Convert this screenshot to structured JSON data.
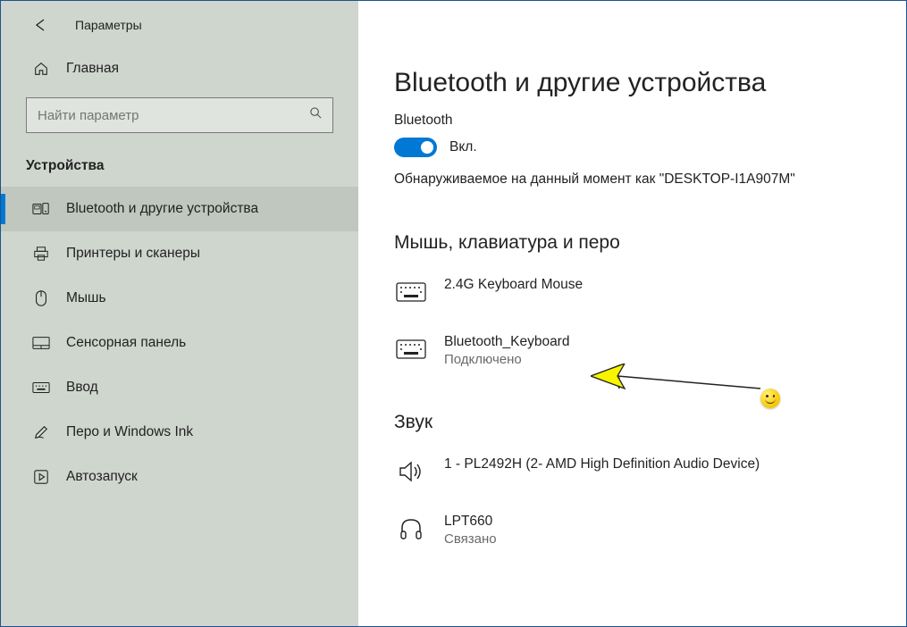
{
  "header": {
    "title": "Параметры"
  },
  "sidebar": {
    "home_label": "Главная",
    "search_placeholder": "Найти параметр",
    "section_label": "Устройства",
    "items": [
      {
        "label": "Bluetooth и другие устройства",
        "icon": "bluetooth-devices"
      },
      {
        "label": "Принтеры и сканеры",
        "icon": "printer"
      },
      {
        "label": "Мышь",
        "icon": "mouse"
      },
      {
        "label": "Сенсорная панель",
        "icon": "touchpad"
      },
      {
        "label": "Ввод",
        "icon": "keyboard"
      },
      {
        "label": "Перо и Windows Ink",
        "icon": "pen"
      },
      {
        "label": "Автозапуск",
        "icon": "autoplay"
      }
    ]
  },
  "main": {
    "title": "Bluetooth и другие устройства",
    "bluetooth_label": "Bluetooth",
    "toggle_state_label": "Вкл.",
    "discoverable_text": "Обнаруживаемое на данный момент как \"DESKTOP-I1A907M\"",
    "section1": {
      "heading": "Мышь, клавиатура и перо",
      "devices": [
        {
          "name": "2.4G Keyboard Mouse",
          "status": "",
          "icon": "keyboard"
        },
        {
          "name": "Bluetooth_Keyboard",
          "status": "Подключено",
          "icon": "keyboard"
        }
      ]
    },
    "section2": {
      "heading": "Звук",
      "devices": [
        {
          "name": "1 - PL2492H (2- AMD High Definition Audio Device)",
          "status": "",
          "icon": "speaker"
        },
        {
          "name": "LPT660",
          "status": "Связано",
          "icon": "headphones"
        }
      ]
    }
  }
}
